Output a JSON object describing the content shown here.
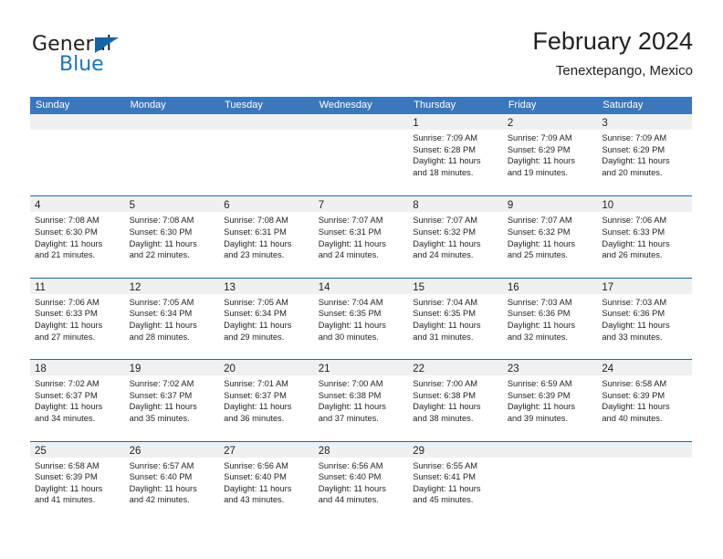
{
  "logo": {
    "word_top": "General",
    "word_bottom": "Blue",
    "triangle_color": "#1464ac",
    "blue_color": "#1b75bb"
  },
  "header": {
    "title": "February 2024",
    "location": "Tenextepango, Mexico"
  },
  "theme": {
    "header_blue": "#3b77bc",
    "row_divider_blue": "#2167ae",
    "day_band_gray": "#f0f0f0",
    "text_color": "#231f20"
  },
  "weekday_headers": [
    "Sunday",
    "Monday",
    "Tuesday",
    "Wednesday",
    "Thursday",
    "Friday",
    "Saturday"
  ],
  "weeks": [
    [
      {
        "day": "",
        "empty": true,
        "lines": []
      },
      {
        "day": "",
        "empty": true,
        "lines": []
      },
      {
        "day": "",
        "empty": true,
        "lines": []
      },
      {
        "day": "",
        "empty": true,
        "lines": []
      },
      {
        "day": "1",
        "empty": false,
        "lines": [
          "Sunrise: 7:09 AM",
          "Sunset: 6:28 PM",
          "Daylight: 11 hours",
          "and 18 minutes."
        ]
      },
      {
        "day": "2",
        "empty": false,
        "lines": [
          "Sunrise: 7:09 AM",
          "Sunset: 6:29 PM",
          "Daylight: 11 hours",
          "and 19 minutes."
        ]
      },
      {
        "day": "3",
        "empty": false,
        "lines": [
          "Sunrise: 7:09 AM",
          "Sunset: 6:29 PM",
          "Daylight: 11 hours",
          "and 20 minutes."
        ]
      }
    ],
    [
      {
        "day": "4",
        "empty": false,
        "lines": [
          "Sunrise: 7:08 AM",
          "Sunset: 6:30 PM",
          "Daylight: 11 hours",
          "and 21 minutes."
        ]
      },
      {
        "day": "5",
        "empty": false,
        "lines": [
          "Sunrise: 7:08 AM",
          "Sunset: 6:30 PM",
          "Daylight: 11 hours",
          "and 22 minutes."
        ]
      },
      {
        "day": "6",
        "empty": false,
        "lines": [
          "Sunrise: 7:08 AM",
          "Sunset: 6:31 PM",
          "Daylight: 11 hours",
          "and 23 minutes."
        ]
      },
      {
        "day": "7",
        "empty": false,
        "lines": [
          "Sunrise: 7:07 AM",
          "Sunset: 6:31 PM",
          "Daylight: 11 hours",
          "and 24 minutes."
        ]
      },
      {
        "day": "8",
        "empty": false,
        "lines": [
          "Sunrise: 7:07 AM",
          "Sunset: 6:32 PM",
          "Daylight: 11 hours",
          "and 24 minutes."
        ]
      },
      {
        "day": "9",
        "empty": false,
        "lines": [
          "Sunrise: 7:07 AM",
          "Sunset: 6:32 PM",
          "Daylight: 11 hours",
          "and 25 minutes."
        ]
      },
      {
        "day": "10",
        "empty": false,
        "lines": [
          "Sunrise: 7:06 AM",
          "Sunset: 6:33 PM",
          "Daylight: 11 hours",
          "and 26 minutes."
        ]
      }
    ],
    [
      {
        "day": "11",
        "empty": false,
        "lines": [
          "Sunrise: 7:06 AM",
          "Sunset: 6:33 PM",
          "Daylight: 11 hours",
          "and 27 minutes."
        ]
      },
      {
        "day": "12",
        "empty": false,
        "lines": [
          "Sunrise: 7:05 AM",
          "Sunset: 6:34 PM",
          "Daylight: 11 hours",
          "and 28 minutes."
        ]
      },
      {
        "day": "13",
        "empty": false,
        "lines": [
          "Sunrise: 7:05 AM",
          "Sunset: 6:34 PM",
          "Daylight: 11 hours",
          "and 29 minutes."
        ]
      },
      {
        "day": "14",
        "empty": false,
        "lines": [
          "Sunrise: 7:04 AM",
          "Sunset: 6:35 PM",
          "Daylight: 11 hours",
          "and 30 minutes."
        ]
      },
      {
        "day": "15",
        "empty": false,
        "lines": [
          "Sunrise: 7:04 AM",
          "Sunset: 6:35 PM",
          "Daylight: 11 hours",
          "and 31 minutes."
        ]
      },
      {
        "day": "16",
        "empty": false,
        "lines": [
          "Sunrise: 7:03 AM",
          "Sunset: 6:36 PM",
          "Daylight: 11 hours",
          "and 32 minutes."
        ]
      },
      {
        "day": "17",
        "empty": false,
        "lines": [
          "Sunrise: 7:03 AM",
          "Sunset: 6:36 PM",
          "Daylight: 11 hours",
          "and 33 minutes."
        ]
      }
    ],
    [
      {
        "day": "18",
        "empty": false,
        "lines": [
          "Sunrise: 7:02 AM",
          "Sunset: 6:37 PM",
          "Daylight: 11 hours",
          "and 34 minutes."
        ]
      },
      {
        "day": "19",
        "empty": false,
        "lines": [
          "Sunrise: 7:02 AM",
          "Sunset: 6:37 PM",
          "Daylight: 11 hours",
          "and 35 minutes."
        ]
      },
      {
        "day": "20",
        "empty": false,
        "lines": [
          "Sunrise: 7:01 AM",
          "Sunset: 6:37 PM",
          "Daylight: 11 hours",
          "and 36 minutes."
        ]
      },
      {
        "day": "21",
        "empty": false,
        "lines": [
          "Sunrise: 7:00 AM",
          "Sunset: 6:38 PM",
          "Daylight: 11 hours",
          "and 37 minutes."
        ]
      },
      {
        "day": "22",
        "empty": false,
        "lines": [
          "Sunrise: 7:00 AM",
          "Sunset: 6:38 PM",
          "Daylight: 11 hours",
          "and 38 minutes."
        ]
      },
      {
        "day": "23",
        "empty": false,
        "lines": [
          "Sunrise: 6:59 AM",
          "Sunset: 6:39 PM",
          "Daylight: 11 hours",
          "and 39 minutes."
        ]
      },
      {
        "day": "24",
        "empty": false,
        "lines": [
          "Sunrise: 6:58 AM",
          "Sunset: 6:39 PM",
          "Daylight: 11 hours",
          "and 40 minutes."
        ]
      }
    ],
    [
      {
        "day": "25",
        "empty": false,
        "lines": [
          "Sunrise: 6:58 AM",
          "Sunset: 6:39 PM",
          "Daylight: 11 hours",
          "and 41 minutes."
        ]
      },
      {
        "day": "26",
        "empty": false,
        "lines": [
          "Sunrise: 6:57 AM",
          "Sunset: 6:40 PM",
          "Daylight: 11 hours",
          "and 42 minutes."
        ]
      },
      {
        "day": "27",
        "empty": false,
        "lines": [
          "Sunrise: 6:56 AM",
          "Sunset: 6:40 PM",
          "Daylight: 11 hours",
          "and 43 minutes."
        ]
      },
      {
        "day": "28",
        "empty": false,
        "lines": [
          "Sunrise: 6:56 AM",
          "Sunset: 6:40 PM",
          "Daylight: 11 hours",
          "and 44 minutes."
        ]
      },
      {
        "day": "29",
        "empty": false,
        "lines": [
          "Sunrise: 6:55 AM",
          "Sunset: 6:41 PM",
          "Daylight: 11 hours",
          "and 45 minutes."
        ]
      },
      {
        "day": "",
        "empty": true,
        "lines": []
      },
      {
        "day": "",
        "empty": true,
        "lines": []
      }
    ]
  ]
}
